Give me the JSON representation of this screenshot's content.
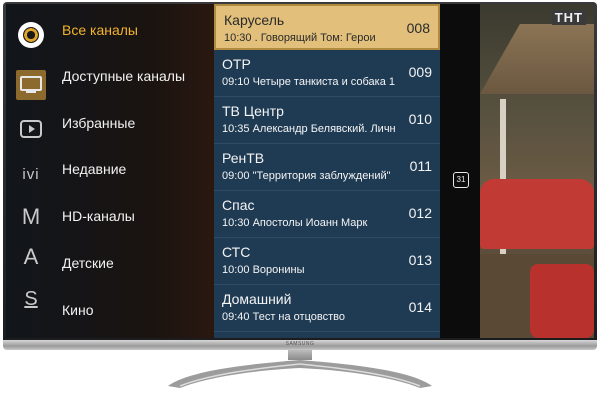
{
  "menu": {
    "items": [
      {
        "label": "Все каналы",
        "selected": true
      },
      {
        "label": "Доступные каналы"
      },
      {
        "label": "Избранные"
      },
      {
        "label": "Недавние"
      },
      {
        "label": "HD-каналы"
      },
      {
        "label": "Детские"
      },
      {
        "label": "Кино"
      }
    ],
    "icons": [
      "logo-icon",
      "tv-icon",
      "play-icon",
      "ivi-icon",
      "m-icon",
      "a-icon",
      "s-icon"
    ]
  },
  "channels": [
    {
      "name": "Карусель",
      "time": "10:30",
      "program": ". Говорящий Том: Герои",
      "number": "008",
      "selected": true
    },
    {
      "name": "ОТР",
      "time": "09:10",
      "program": "Четыре танкиста и собака 1",
      "number": "009"
    },
    {
      "name": "ТВ Центр",
      "time": "10:35",
      "program": "Александр Белявский. Личн",
      "number": "010"
    },
    {
      "name": "РенТВ",
      "time": "09:00",
      "program": "\"Территория заблуждений\"",
      "number": "011"
    },
    {
      "name": "Спас",
      "time": "10:30",
      "program": "Апостолы Иоанн Марк",
      "number": "012"
    },
    {
      "name": "СТС",
      "time": "10:00",
      "program": "Воронины",
      "number": "013"
    },
    {
      "name": "Домашний",
      "time": "09:40",
      "program": "Тест на отцовство",
      "number": "014"
    }
  ],
  "preview": {
    "channel_logo": "ТНТ",
    "calendar_day": "31"
  },
  "tv": {
    "brand": "SAMSUNG"
  },
  "colors": {
    "accent": "#f3b32a",
    "selected_row": "#e2c07c",
    "list_bg": "#1f3b54"
  }
}
